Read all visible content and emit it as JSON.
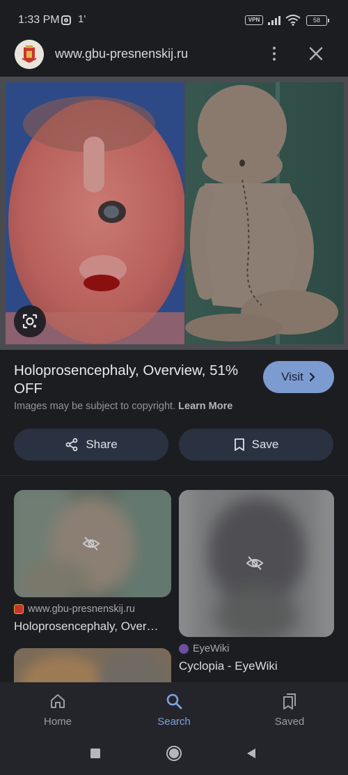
{
  "status_bar": {
    "time": "1:33 PM",
    "network_indicator": "1'",
    "vpn_label": "VPN",
    "battery": "58"
  },
  "header": {
    "url": "www.gbu-presnenskij.ru",
    "favicon": "city-crest-icon",
    "menu_icon": "more-vert-icon",
    "close_icon": "close-icon"
  },
  "result": {
    "title": "Holoprosencephaly, Overview, 51% OFF",
    "visit_label": "Visit",
    "copyright_text": "Images may be subject to copyright.",
    "learn_more": "Learn More",
    "share_label": "Share",
    "save_label": "Save",
    "accent_color": "#7c9bd0"
  },
  "related": [
    {
      "source": "www.gbu-presnenskij.ru",
      "title": "Holoprosencephaly, Over…",
      "hidden_icon": "eye-off-icon"
    },
    {
      "source": "EyeWiki",
      "title": "Cyclopia - EyeWiki",
      "hidden_icon": "eye-off-icon"
    },
    {
      "source": "",
      "title": ""
    }
  ],
  "bottom_nav": {
    "items": [
      {
        "label": "Home",
        "icon": "home-icon",
        "active": false
      },
      {
        "label": "Search",
        "icon": "search-icon",
        "active": true
      },
      {
        "label": "Saved",
        "icon": "saved-icon",
        "active": false
      }
    ]
  }
}
